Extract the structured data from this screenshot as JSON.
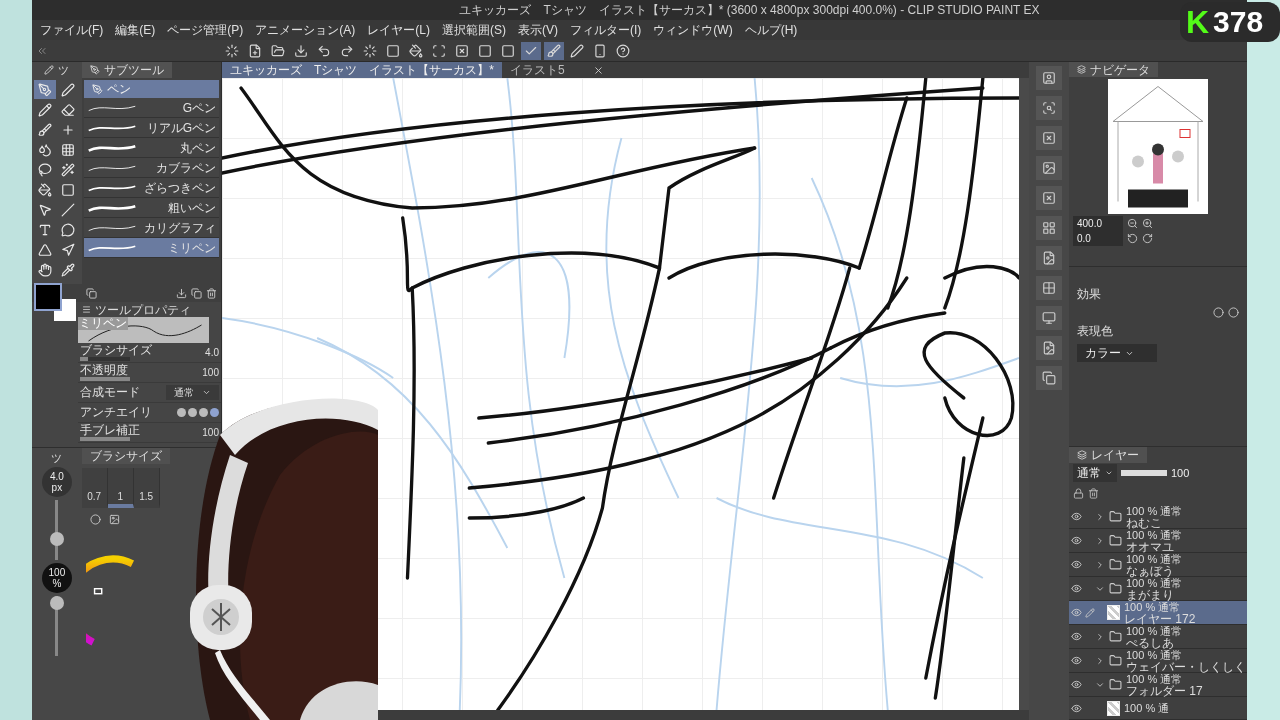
{
  "window": {
    "title": "ユキッカーズ　Tシャツ　イラスト【サーカス】* (3600 x 4800px 300dpi 400.0%)  - CLIP STUDIO PAINT EX"
  },
  "overlay": {
    "logo": "K",
    "viewers": "378"
  },
  "menu": [
    "ファイル(F)",
    "編集(E)",
    "ページ管理(P)",
    "アニメーション(A)",
    "レイヤー(L)",
    "選択範囲(S)",
    "表示(V)",
    "フィルター(I)",
    "ウィンドウ(W)",
    "ヘルプ(H)"
  ],
  "document_tabs": [
    {
      "label": "ユキッカーズ　Tシャツ　イラスト【サーカス】*",
      "selected": true
    },
    {
      "label": "イラスト5",
      "selected": false
    }
  ],
  "tool_palette": {
    "tab": "ツ",
    "colors": [
      {
        "kind": "main",
        "color": "#000000"
      },
      {
        "kind": "sub",
        "color": "#ffffff"
      }
    ],
    "tools": [
      {
        "selected": true
      },
      {
        "selected": false
      },
      {
        "selected": false
      },
      {
        "selected": false
      },
      {
        "selected": false
      },
      {
        "selected": false
      },
      {
        "selected": false
      },
      {
        "selected": false
      },
      {
        "selected": false
      },
      {
        "selected": false
      },
      {
        "selected": false
      },
      {
        "selected": false
      },
      {
        "selected": false
      },
      {
        "selected": false
      },
      {
        "selected": false
      },
      {
        "selected": false
      },
      {
        "selected": false
      },
      {
        "selected": false
      },
      {
        "selected": false
      },
      {
        "selected": false
      }
    ]
  },
  "subtool": {
    "title": "サブツール",
    "group": "ペン",
    "items": [
      {
        "label": "Gペン",
        "selected": false
      },
      {
        "label": "リアルGペン",
        "selected": false
      },
      {
        "label": "丸ペン",
        "selected": false
      },
      {
        "label": "カブラペン",
        "selected": false
      },
      {
        "label": "ざらつきペン",
        "selected": false
      },
      {
        "label": "粗いペン",
        "selected": false
      },
      {
        "label": "カリグラフィ",
        "selected": false
      },
      {
        "label": "ミリペン",
        "selected": true
      }
    ]
  },
  "tool_property": {
    "title": "ツールプロパティ",
    "preview_label": "ミリペン",
    "rows": [
      {
        "kind": "value",
        "label": "ブラシサイズ",
        "value": "4.0",
        "level": 0.15
      },
      {
        "kind": "value",
        "label": "不透明度",
        "value": "100",
        "level": 1
      },
      {
        "kind": "select",
        "label": "合成モード",
        "value": "通常"
      },
      {
        "kind": "swatches",
        "label": "アンチエイリ"
      },
      {
        "kind": "value",
        "label": "手ブレ補正",
        "value": "100",
        "level": 1
      }
    ]
  },
  "quick_sliders": {
    "tab": "ツ",
    "size": {
      "value": "4.0",
      "unit": "px",
      "level": 0.3
    },
    "opacity": {
      "value": "100",
      "unit": "%",
      "level": 1
    }
  },
  "brush_size": {
    "title": "ブラシサイズ",
    "sizes": [
      {
        "label": "0.7",
        "selected": false
      },
      {
        "label": "1",
        "selected": true
      },
      {
        "label": "1.5",
        "selected": false
      }
    ]
  },
  "navigator": {
    "title": "ナビゲータ",
    "zoom": "400.0",
    "rotation": "0.0"
  },
  "layer_property": {
    "effect_label": "効果",
    "color_label": "表現色",
    "color_mode": "カラー"
  },
  "layers": {
    "title": "レイヤー",
    "blend": "通常",
    "opacity": {
      "value": "100",
      "level": 1
    },
    "items": [
      {
        "kind": "folder",
        "info": "100 % 通常",
        "name": "ねむこ",
        "expanded": false,
        "selected": false,
        "visible": true
      },
      {
        "kind": "folder",
        "info": "100 % 通常",
        "name": "オオマユ",
        "expanded": false,
        "selected": false,
        "visible": true
      },
      {
        "kind": "folder",
        "info": "100 % 通常",
        "name": "なぁぼう",
        "expanded": false,
        "selected": false,
        "visible": true
      },
      {
        "kind": "folder",
        "info": "100 % 通常",
        "name": "まがまり",
        "expanded": true,
        "selected": false,
        "visible": true,
        "children": [
          {
            "kind": "layer",
            "info": "100 % 通常",
            "name": "レイヤー 172",
            "selected": true,
            "visible": true
          }
        ]
      },
      {
        "kind": "folder",
        "info": "100 % 通常",
        "name": "ぺるしあ",
        "expanded": false,
        "selected": false,
        "visible": true
      },
      {
        "kind": "folder",
        "info": "100 % 通常",
        "name": "ウェイバー・しくしく",
        "expanded": false,
        "selected": false,
        "visible": true
      },
      {
        "kind": "folder",
        "info": "100 % 通常",
        "name": "フォルダー 17",
        "expanded": true,
        "selected": false,
        "visible": true,
        "children": [
          {
            "kind": "layer",
            "info": "100 % 通",
            "selected": false,
            "visible": true
          }
        ]
      }
    ]
  }
}
